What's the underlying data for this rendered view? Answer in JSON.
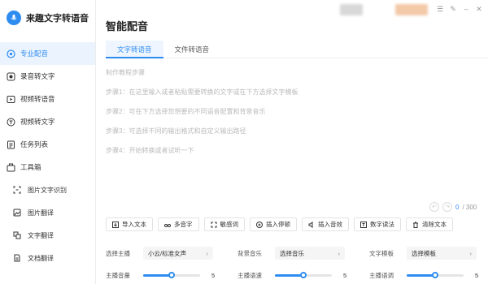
{
  "app": {
    "name": "来趣文字转语音"
  },
  "sidebar": {
    "items": [
      {
        "label": "专业配音",
        "icon": "microphone-icon",
        "active": true
      },
      {
        "label": "录音转文字",
        "icon": "record-icon"
      },
      {
        "label": "视频转语音",
        "icon": "video-icon"
      },
      {
        "label": "视频转文字",
        "icon": "video-text-icon"
      },
      {
        "label": "任务列表",
        "icon": "task-list-icon"
      },
      {
        "label": "工具箱",
        "icon": "toolbox-icon"
      }
    ],
    "sub_items": [
      {
        "label": "图片文字识别",
        "icon": "image-text-icon"
      },
      {
        "label": "图片翻译",
        "icon": "image-translate-icon"
      },
      {
        "label": "文字翻译",
        "icon": "text-translate-icon"
      },
      {
        "label": "文档翻译",
        "icon": "doc-translate-icon"
      }
    ]
  },
  "main": {
    "title": "智能配音",
    "tabs": [
      {
        "label": "文字转语音",
        "active": true
      },
      {
        "label": "文件转语音",
        "active": false
      }
    ],
    "editor_lines": [
      "制作教程步骤",
      "步骤1：在这里输入或者粘贴需要转换的文字或在下方选择文字模板",
      "步骤2：可在下方选择您想要的不同语音配置和背景音乐",
      "步骤3：可选择不同的输出格式和自定义输出路径",
      "步骤4：开始转换或者试听一下"
    ],
    "counter": {
      "current": "0",
      "total": "/ 300"
    },
    "toolbar": [
      {
        "label": "导入文本",
        "icon": "import-icon"
      },
      {
        "label": "多音字",
        "icon": "polyphone-icon"
      },
      {
        "label": "敏感词",
        "icon": "sensitive-word-icon"
      },
      {
        "label": "插入停顿",
        "icon": "pause-icon"
      },
      {
        "label": "插入音效",
        "icon": "sound-effect-icon"
      },
      {
        "label": "数字读法",
        "icon": "number-read-icon"
      },
      {
        "label": "清除文本",
        "icon": "trash-icon"
      }
    ],
    "settings": {
      "anchor": {
        "label": "选择主播",
        "value": "小云/标准女声"
      },
      "bgm": {
        "label": "背景音乐",
        "value": "选择音乐"
      },
      "template": {
        "label": "文字模板",
        "value": "选择模板"
      },
      "volume": {
        "label": "主播音量",
        "value": "5",
        "level": 0.5
      },
      "speed": {
        "label": "主播语速",
        "value": "5",
        "level": 0.5
      },
      "pitch": {
        "label": "主播语调",
        "value": "5",
        "level": 0.5
      }
    }
  },
  "colors": {
    "accent": "#2e8cf0"
  }
}
